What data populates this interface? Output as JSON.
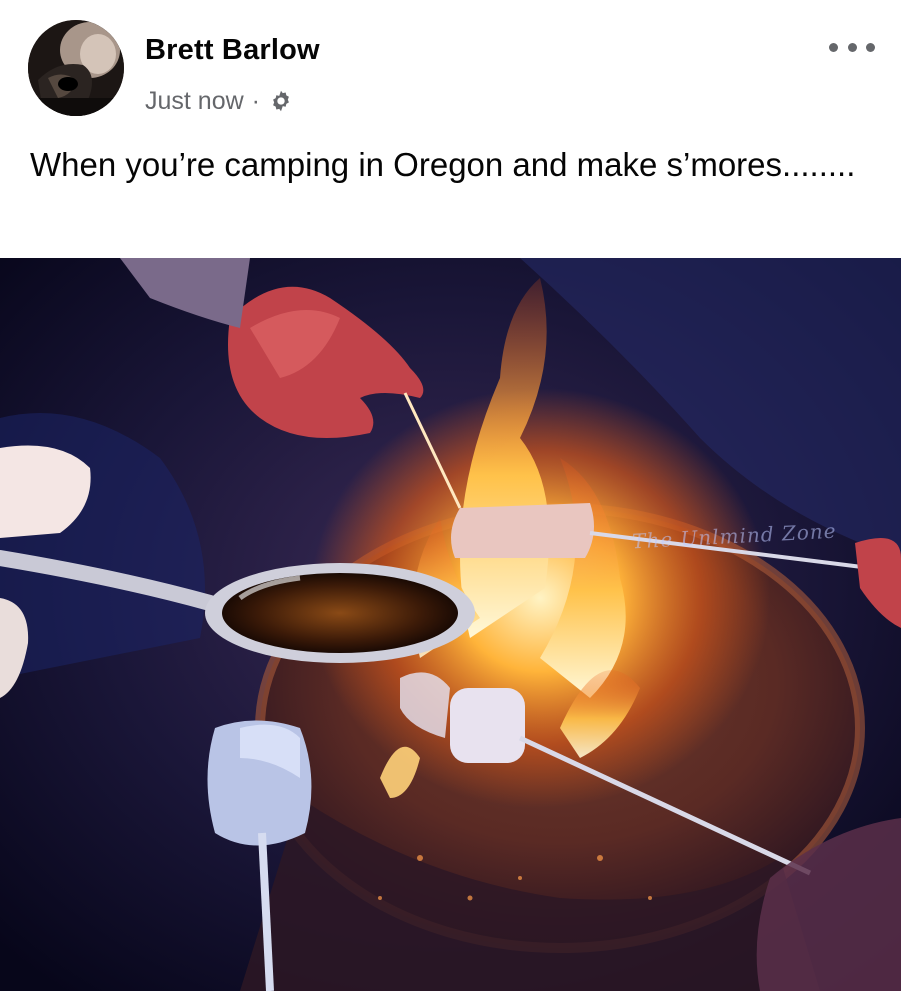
{
  "post": {
    "author": "Brett Barlow",
    "timestamp": "Just now",
    "separator": "·",
    "privacy_icon": "gear-icon",
    "more_icon": "ellipsis-icon",
    "text": "When you’re camping in Oregon and make s’mores........",
    "image": {
      "watermark": "The Unlmind Zone"
    }
  }
}
